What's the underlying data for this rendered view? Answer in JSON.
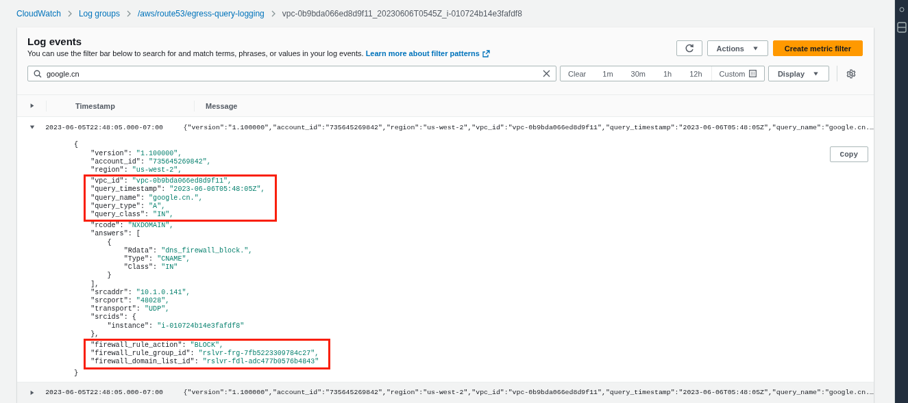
{
  "breadcrumbs": [
    {
      "label": "CloudWatch",
      "link": true
    },
    {
      "label": "Log groups",
      "link": true
    },
    {
      "label": "/aws/route53/egress-query-logging",
      "link": true
    },
    {
      "label": "vpc-0b9bda066ed8d9f11_20230606T0545Z_i-010724b14e3fafdf8",
      "link": false
    }
  ],
  "panel": {
    "title": "Log events",
    "description": "You can use the filter bar below to search for and match terms, phrases, or values in your log events.",
    "learn_more": "Learn more about filter patterns",
    "actions_button": "Actions",
    "create_button": "Create metric filter"
  },
  "filter": {
    "value": "google.cn",
    "range_buttons": [
      "Clear",
      "1m",
      "30m",
      "1h",
      "12h",
      "Custom"
    ],
    "display_button": "Display"
  },
  "table": {
    "columns": [
      "Timestamp",
      "Message"
    ],
    "rows": [
      {
        "timestamp": "2023-06-05T22:48:05.000-07:00",
        "message": "{\"version\":\"1.100000\",\"account_id\":\"735645269842\",\"region\":\"us-west-2\",\"vpc_id\":\"vpc-0b9bda066ed8d9f11\",\"query_timestamp\":\"2023-06-06T05:48:05Z\",\"query_name\":\"google.cn.…",
        "expanded": true,
        "copy_button": "Copy",
        "detail": {
          "open": "{",
          "close": "}",
          "children": [
            {
              "key": "\"version\": ",
              "value": "\"1.100000\","
            },
            {
              "key": "\"account_id\": ",
              "value": "\"735645269842\","
            },
            {
              "key": "\"region\": ",
              "value": "\"us-west-2\","
            },
            {
              "key": "\"vpc_id\": ",
              "value": "\"vpc-0b9bda066ed8d9f11\",",
              "highlighted": true
            },
            {
              "key": "\"query_timestamp\": ",
              "value": "\"2023-06-06T05:48:05Z\",",
              "highlighted": true
            },
            {
              "key": "\"query_name\": ",
              "value": "\"google.cn.\",",
              "highlighted": true
            },
            {
              "key": "\"query_type\": ",
              "value": "\"A\",",
              "highlighted": true
            },
            {
              "key": "\"query_class\": ",
              "value": "\"IN\",",
              "highlighted": true
            },
            {
              "key": "\"rcode\": ",
              "value": "\"NXDOMAIN\","
            },
            {
              "key": "\"answers\": [",
              "close": "],",
              "children": [
                {
                  "key": "{",
                  "close": "}",
                  "children": [
                    {
                      "key": "\"Rdata\": ",
                      "value": "\"dns_firewall_block.\","
                    },
                    {
                      "key": "\"Type\": ",
                      "value": "\"CNAME\","
                    },
                    {
                      "key": "\"Class\": ",
                      "value": "\"IN\""
                    }
                  ]
                }
              ]
            },
            {
              "key": "\"srcaddr\": ",
              "value": "\"10.1.0.141\","
            },
            {
              "key": "\"srcport\": ",
              "value": "\"48028\","
            },
            {
              "key": "\"transport\": ",
              "value": "\"UDP\","
            },
            {
              "key": "\"srcids\": {",
              "close": "},",
              "children": [
                {
                  "key": "\"instance\": ",
                  "value": "\"i-010724b14e3fafdf8\""
                }
              ]
            },
            {
              "key": "\"firewall_rule_action\": ",
              "value": "\"BLOCK\",",
              "highlighted": true
            },
            {
              "key": "\"firewall_rule_group_id\": ",
              "value": "\"rslvr-frg-7fb5223309784c27\",",
              "highlighted": true
            },
            {
              "key": "\"firewall_domain_list_id\": ",
              "value": "\"rslvr-fdl-adc477b0576b4843\"",
              "highlighted": true
            }
          ]
        }
      },
      {
        "timestamp": "2023-06-05T22:48:05.000-07:00",
        "message": "{\"version\":\"1.100000\",\"account_id\":\"735645269842\",\"region\":\"us-west-2\",\"vpc_id\":\"vpc-0b9bda066ed8d9f11\",\"query_timestamp\":\"2023-06-06T05:48:05Z\",\"query_name\":\"google.cn.…",
        "expanded": false
      }
    ]
  }
}
